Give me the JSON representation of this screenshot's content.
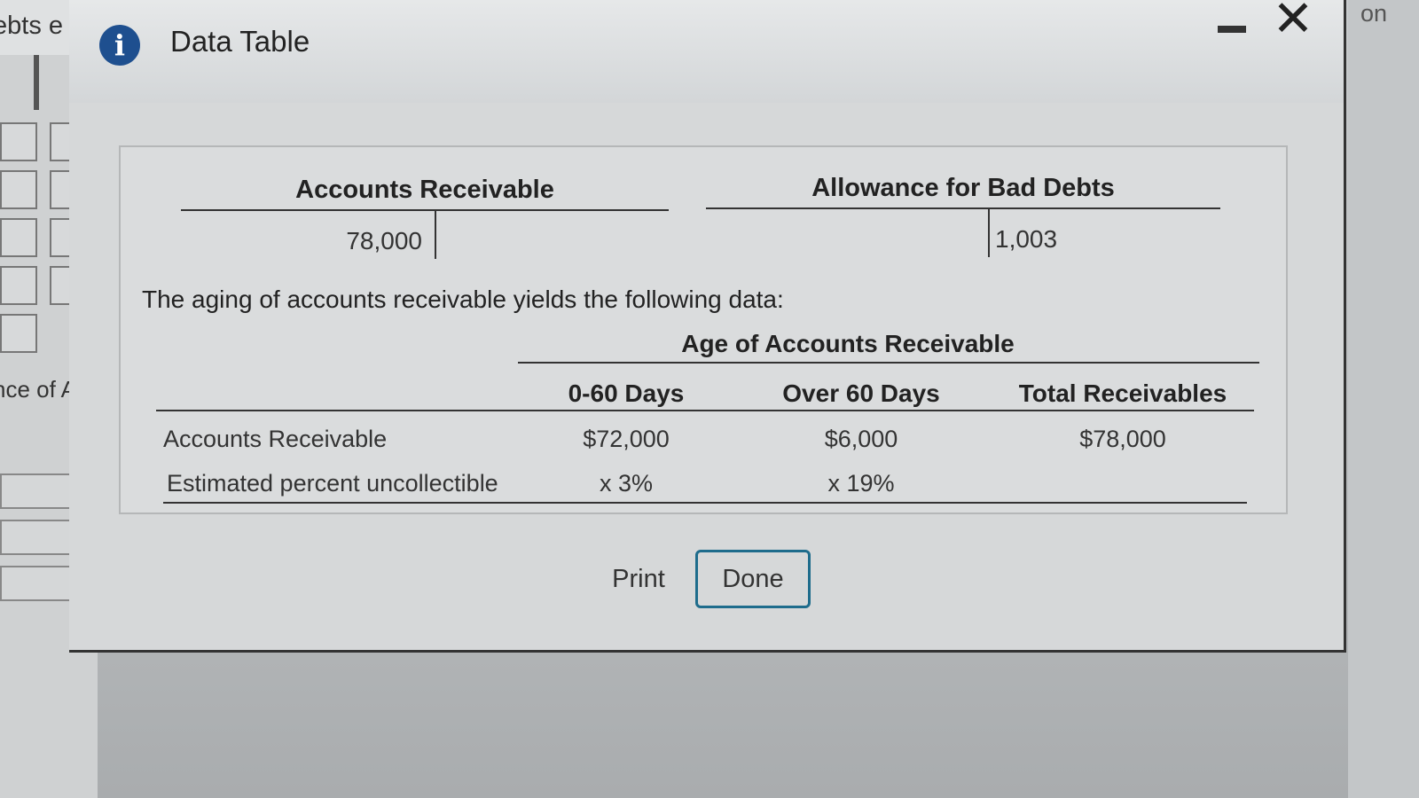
{
  "background": {
    "left_fragment_top": "ebts e",
    "left_fragment_mid": "nce of All",
    "right_fragment": "on"
  },
  "dialog": {
    "title": "Data Table",
    "icon": "info-icon",
    "minimize_icon": "minimize-icon",
    "close_icon": "close-icon",
    "accent_color": "#1e4f8f"
  },
  "t_accounts": [
    {
      "title": "Accounts Receivable",
      "debit": "78,000",
      "credit": ""
    },
    {
      "title": "Allowance for Bad Debts",
      "debit": "",
      "credit": "1,003"
    }
  ],
  "intro_text": "The aging of accounts receivable yields the following data:",
  "aging_table": {
    "group_header": "Age of Accounts Receivable",
    "columns": [
      "0-60 Days",
      "Over 60 Days",
      "Total Receivables"
    ],
    "rows": [
      {
        "label": "Accounts Receivable",
        "values": [
          "$72,000",
          "$6,000",
          "$78,000"
        ]
      },
      {
        "label": "Estimated percent uncollectible",
        "values": [
          "x 3%",
          "x 19%",
          ""
        ]
      }
    ]
  },
  "buttons": {
    "print": "Print",
    "done": "Done"
  }
}
